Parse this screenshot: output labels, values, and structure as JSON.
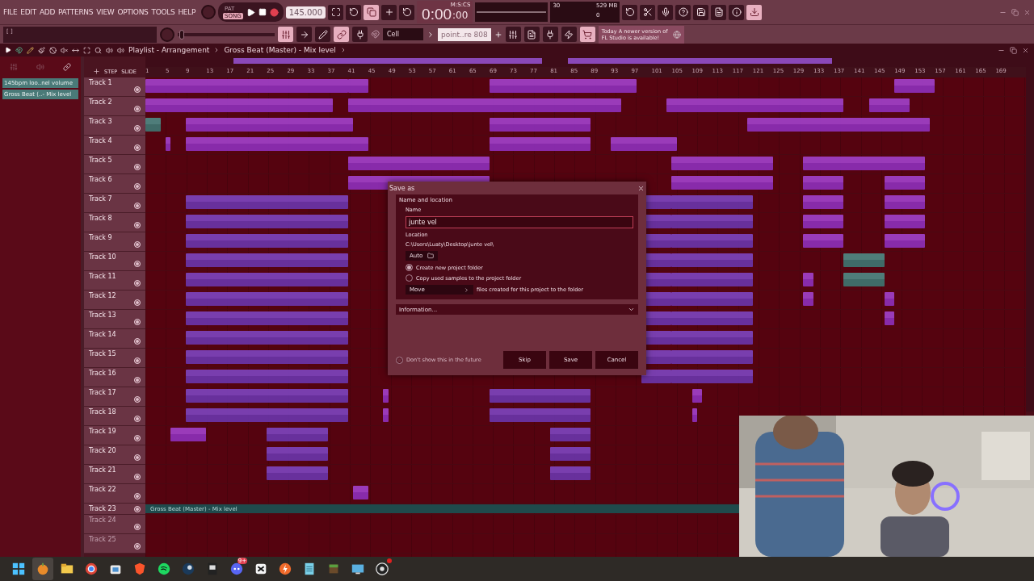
{
  "menu": [
    "FILE",
    "EDIT",
    "ADD",
    "PATTERNS",
    "VIEW",
    "OPTIONS",
    "TOOLS",
    "HELP"
  ],
  "hint": "[ ]",
  "transport": {
    "modes": [
      {
        "label": "PAT",
        "selected": false
      },
      {
        "label": "SONG",
        "selected": true
      }
    ],
    "tempo": "145.000",
    "master": {
      "level": 0.02
    }
  },
  "time": {
    "main": "0:00",
    "sub": ":00",
    "unit": "M:S:CS"
  },
  "monitor": {
    "cpu": "30",
    "ram": "529 MB",
    "voices": "0"
  },
  "snap": "Cell",
  "pattern": "point..re 808",
  "news": {
    "date": "Today",
    "text": "A newer version of FL Studio is available!"
  },
  "browser": {
    "items": [
      {
        "label": "145bpm loo..nel volume"
      },
      {
        "label": "Gross Beat (..- Mix level"
      }
    ]
  },
  "playlist": {
    "title": "Playlist - Arrangement",
    "path": "Gross Beat (Master) - Mix level",
    "step_label": "STEP",
    "slide_label": "SLIDE",
    "ruler": [
      "1",
      "5",
      "9",
      "13",
      "17",
      "21",
      "25",
      "29",
      "33",
      "37",
      "41",
      "45",
      "49",
      "53",
      "57",
      "61",
      "65",
      "69",
      "73",
      "77",
      "81",
      "85",
      "89",
      "93",
      "97",
      "101",
      "105",
      "109",
      "113",
      "117",
      "121",
      "125",
      "129",
      "133",
      "137",
      "141",
      "145",
      "149",
      "153",
      "157",
      "161",
      "165",
      "169"
    ],
    "tracks": [
      {
        "name": "Track 1",
        "kind": "normal",
        "dim": false,
        "on": true,
        "clips": [
          {
            "kind": "audio"
          },
          {
            "kind": "audio"
          },
          {
            "kind": "audio"
          },
          {
            "kind": "audio"
          }
        ]
      },
      {
        "name": "Track 2",
        "kind": "normal",
        "dim": false,
        "on": true,
        "clips": [
          {
            "kind": "audio"
          },
          {
            "kind": "audio"
          },
          {
            "kind": "audio"
          },
          {
            "kind": "audio"
          }
        ]
      },
      {
        "name": "Track 3",
        "kind": "normal",
        "dim": false,
        "on": true,
        "clips": [
          {
            "kind": "automation"
          },
          {
            "kind": "audio"
          },
          {
            "kind": "audio"
          },
          {
            "kind": "audio"
          }
        ]
      },
      {
        "name": "Track 4",
        "kind": "normal",
        "dim": false,
        "on": true,
        "clips": [
          {
            "kind": "audio"
          },
          {
            "kind": "audio"
          },
          {
            "kind": "audio"
          },
          {
            "kind": "audio"
          }
        ]
      },
      {
        "name": "Track 5",
        "kind": "normal",
        "dim": false,
        "on": true,
        "clips": [
          {
            "kind": "audio"
          },
          {
            "kind": "audio"
          },
          {
            "kind": "audio"
          }
        ]
      },
      {
        "name": "Track 6",
        "kind": "normal",
        "dim": false,
        "on": true,
        "clips": [
          {
            "kind": "audio"
          },
          {
            "kind": "audio"
          },
          {
            "kind": "audio"
          },
          {
            "kind": "audio"
          }
        ]
      },
      {
        "name": "Track 7",
        "kind": "normal",
        "dim": false,
        "on": true,
        "clips": [
          {
            "kind": "pattern"
          },
          {
            "kind": "pattern"
          },
          {
            "kind": "pattern"
          },
          {
            "kind": "audio"
          },
          {
            "kind": "audio"
          }
        ]
      },
      {
        "name": "Track 8",
        "kind": "normal",
        "dim": false,
        "on": true,
        "clips": [
          {
            "kind": "pattern"
          },
          {
            "kind": "pattern"
          },
          {
            "kind": "pattern"
          },
          {
            "kind": "audio"
          },
          {
            "kind": "audio"
          }
        ]
      },
      {
        "name": "Track 9",
        "kind": "normal",
        "dim": false,
        "on": true,
        "clips": [
          {
            "kind": "pattern"
          },
          {
            "kind": "pattern"
          },
          {
            "kind": "pattern"
          },
          {
            "kind": "audio"
          },
          {
            "kind": "audio"
          }
        ]
      },
      {
        "name": "Track 10",
        "kind": "normal",
        "dim": false,
        "on": true,
        "clips": [
          {
            "kind": "pattern"
          },
          {
            "kind": "pattern"
          },
          {
            "kind": "pattern"
          },
          {
            "kind": "automation"
          }
        ]
      },
      {
        "name": "Track 11",
        "kind": "normal",
        "dim": false,
        "on": true,
        "clips": [
          {
            "kind": "pattern"
          },
          {
            "kind": "pattern"
          },
          {
            "kind": "pattern"
          },
          {
            "kind": "audio"
          },
          {
            "kind": "automation"
          }
        ]
      },
      {
        "name": "Track 12",
        "kind": "normal",
        "dim": false,
        "on": true,
        "clips": [
          {
            "kind": "pattern"
          },
          {
            "kind": "pattern"
          },
          {
            "kind": "pattern"
          },
          {
            "kind": "audio"
          },
          {
            "kind": "audio"
          }
        ]
      },
      {
        "name": "Track 13",
        "kind": "normal",
        "dim": false,
        "on": true,
        "clips": [
          {
            "kind": "pattern"
          },
          {
            "kind": "pattern"
          },
          {
            "kind": "pattern"
          },
          {
            "kind": "audio"
          }
        ]
      },
      {
        "name": "Track 14",
        "kind": "normal",
        "dim": false,
        "on": true,
        "clips": [
          {
            "kind": "pattern"
          },
          {
            "kind": "pattern"
          },
          {
            "kind": "pattern"
          }
        ]
      },
      {
        "name": "Track 15",
        "kind": "normal",
        "dim": false,
        "on": true,
        "clips": [
          {
            "kind": "pattern"
          },
          {
            "kind": "pattern"
          },
          {
            "kind": "pattern"
          }
        ]
      },
      {
        "name": "Track 16",
        "kind": "normal",
        "dim": false,
        "on": true,
        "clips": [
          {
            "kind": "pattern"
          },
          {
            "kind": "pattern"
          },
          {
            "kind": "pattern"
          }
        ]
      },
      {
        "name": "Track 17",
        "kind": "normal",
        "dim": false,
        "on": true,
        "clips": [
          {
            "kind": "pattern"
          },
          {
            "kind": "audio"
          },
          {
            "kind": "pattern"
          },
          {
            "kind": "audio"
          }
        ]
      },
      {
        "name": "Track 18",
        "kind": "normal",
        "dim": false,
        "on": true,
        "clips": [
          {
            "kind": "pattern"
          },
          {
            "kind": "audio"
          },
          {
            "kind": "pattern"
          },
          {
            "kind": "audio"
          }
        ]
      },
      {
        "name": "Track 19",
        "kind": "normal",
        "dim": false,
        "on": true,
        "clips": [
          {
            "kind": "audio"
          },
          {
            "kind": "pattern"
          },
          {
            "kind": "pattern"
          }
        ]
      },
      {
        "name": "Track 20",
        "kind": "normal",
        "dim": false,
        "on": true,
        "clips": [
          {
            "kind": "pattern"
          },
          {
            "kind": "pattern"
          }
        ]
      },
      {
        "name": "Track 21",
        "kind": "normal",
        "dim": false,
        "on": true,
        "clips": [
          {
            "kind": "pattern"
          },
          {
            "kind": "pattern"
          }
        ]
      },
      {
        "name": "Track 22",
        "kind": "normal",
        "dim": false,
        "on": true,
        "clips": [
          {
            "kind": "audio"
          }
        ]
      },
      {
        "name": "Track 23",
        "kind": "automation",
        "dim": false,
        "on": true,
        "lane_label": "Gross Beat (Master) - Mix level"
      },
      {
        "name": "Track 24",
        "kind": "normal",
        "dim": true,
        "on": true
      },
      {
        "name": "Track 25",
        "kind": "normal",
        "dim": true,
        "on": true
      }
    ]
  },
  "dialog": {
    "title": "Save as",
    "section": "Name and location",
    "name_label": "Name",
    "name_value": "junte vel",
    "location_label": "Location",
    "location_path": "C:\\Users\\Luaty\\Desktop\\junte vel\\",
    "location_mode": "Auto",
    "options": [
      {
        "label": "Create new project folder",
        "selected": true
      },
      {
        "label": "Copy used samples to the project folder",
        "selected": false
      }
    ],
    "move_mode": "Move",
    "move_text": "files created for this project to the folder",
    "info": {
      "label": "Information...",
      "expanded": false
    },
    "dont_show": {
      "label": "Don't show this in the future",
      "checked": false
    },
    "buttons": [
      "Skip",
      "Save",
      "Cancel"
    ]
  },
  "taskbar": {
    "apps": [
      {
        "kind": "windows",
        "selected": false
      },
      {
        "kind": "fruit",
        "selected": true
      },
      {
        "kind": "folder",
        "selected": false
      },
      {
        "kind": "ring",
        "selected": false
      },
      {
        "kind": "bag",
        "selected": false
      },
      {
        "kind": "shield",
        "selected": false
      },
      {
        "kind": "disc",
        "selected": false
      },
      {
        "kind": "disc-dark",
        "selected": false
      },
      {
        "kind": "tile",
        "selected": false
      },
      {
        "kind": "chat",
        "selected": false,
        "badge": "9+"
      },
      {
        "kind": "tile-white",
        "selected": false
      },
      {
        "kind": "bolt",
        "selected": false
      },
      {
        "kind": "note",
        "selected": false
      },
      {
        "kind": "block",
        "selected": false
      },
      {
        "kind": "screen",
        "selected": false
      },
      {
        "kind": "aperture",
        "selected": false,
        "alert": true
      }
    ]
  }
}
